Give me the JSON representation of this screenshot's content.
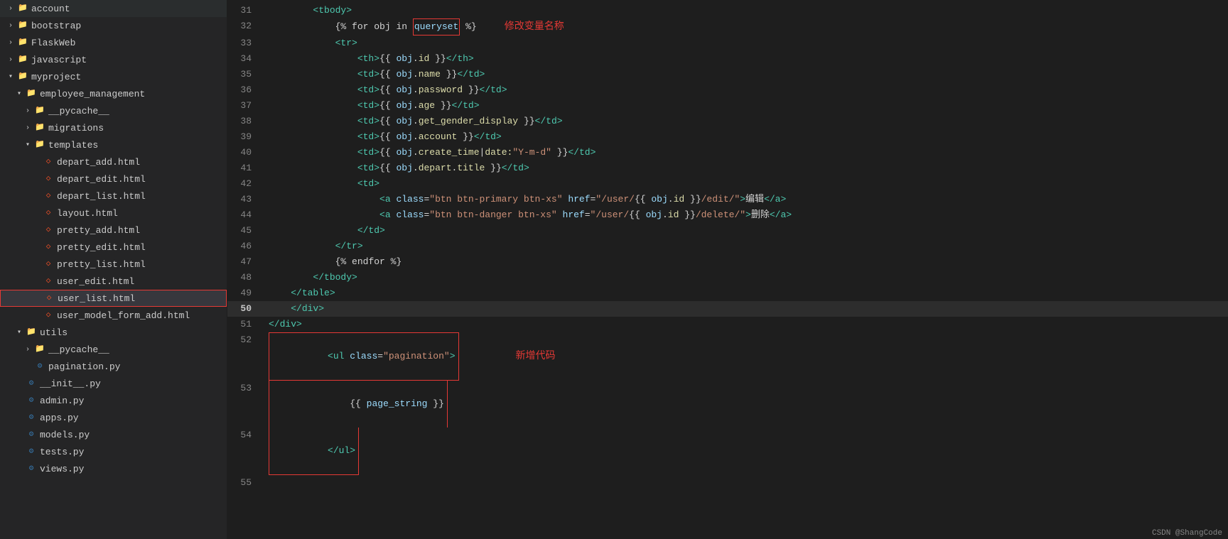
{
  "sidebar": {
    "items": [
      {
        "id": "account",
        "label": "account",
        "type": "folder",
        "indent": 0,
        "state": "closed"
      },
      {
        "id": "bootstrap",
        "label": "bootstrap",
        "type": "folder",
        "indent": 0,
        "state": "closed"
      },
      {
        "id": "flaskweb",
        "label": "FlaskWeb",
        "type": "folder",
        "indent": 0,
        "state": "closed"
      },
      {
        "id": "javascript",
        "label": "javascript",
        "type": "folder",
        "indent": 0,
        "state": "closed"
      },
      {
        "id": "myproject",
        "label": "myproject",
        "type": "folder",
        "indent": 0,
        "state": "open"
      },
      {
        "id": "employee_management",
        "label": "employee_management",
        "type": "folder",
        "indent": 1,
        "state": "open"
      },
      {
        "id": "pycache1",
        "label": "__pycache__",
        "type": "folder",
        "indent": 2,
        "state": "closed"
      },
      {
        "id": "migrations",
        "label": "migrations",
        "type": "folder",
        "indent": 2,
        "state": "closed"
      },
      {
        "id": "templates",
        "label": "templates",
        "type": "folder",
        "indent": 2,
        "state": "open"
      },
      {
        "id": "depart_add",
        "label": "depart_add.html",
        "type": "html",
        "indent": 3,
        "state": "file"
      },
      {
        "id": "depart_edit",
        "label": "depart_edit.html",
        "type": "html",
        "indent": 3,
        "state": "file"
      },
      {
        "id": "depart_list",
        "label": "depart_list.html",
        "type": "html",
        "indent": 3,
        "state": "file"
      },
      {
        "id": "layout",
        "label": "layout.html",
        "type": "html",
        "indent": 3,
        "state": "file"
      },
      {
        "id": "pretty_add",
        "label": "pretty_add.html",
        "type": "html",
        "indent": 3,
        "state": "file"
      },
      {
        "id": "pretty_edit",
        "label": "pretty_edit.html",
        "type": "html",
        "indent": 3,
        "state": "file"
      },
      {
        "id": "pretty_list",
        "label": "pretty_list.html",
        "type": "html",
        "indent": 3,
        "state": "file"
      },
      {
        "id": "user_edit",
        "label": "user_edit.html",
        "type": "html",
        "indent": 3,
        "state": "file"
      },
      {
        "id": "user_list",
        "label": "user_list.html",
        "type": "html",
        "indent": 3,
        "state": "file",
        "selected": true
      },
      {
        "id": "user_model_form_add",
        "label": "user_model_form_add.html",
        "type": "html",
        "indent": 3,
        "state": "file"
      },
      {
        "id": "utils",
        "label": "utils",
        "type": "folder",
        "indent": 1,
        "state": "open"
      },
      {
        "id": "pycache2",
        "label": "__pycache__",
        "type": "folder",
        "indent": 2,
        "state": "closed"
      },
      {
        "id": "pagination_py",
        "label": "pagination.py",
        "type": "py",
        "indent": 2,
        "state": "file"
      },
      {
        "id": "init_py",
        "label": "__init__.py",
        "type": "py",
        "indent": 1,
        "state": "file"
      },
      {
        "id": "admin_py",
        "label": "admin.py",
        "type": "py",
        "indent": 1,
        "state": "file"
      },
      {
        "id": "apps_py",
        "label": "apps.py",
        "type": "py",
        "indent": 1,
        "state": "file"
      },
      {
        "id": "models_py",
        "label": "models.py",
        "type": "py",
        "indent": 1,
        "state": "file"
      },
      {
        "id": "tests_py",
        "label": "tests.py",
        "type": "py",
        "indent": 1,
        "state": "file"
      },
      {
        "id": "views_py",
        "label": "views.py",
        "type": "py",
        "indent": 1,
        "state": "file"
      }
    ]
  },
  "editor": {
    "lines": [
      {
        "num": 31,
        "active": false
      },
      {
        "num": 32,
        "active": false
      },
      {
        "num": 33,
        "active": false
      },
      {
        "num": 34,
        "active": false
      },
      {
        "num": 35,
        "active": false
      },
      {
        "num": 36,
        "active": false
      },
      {
        "num": 37,
        "active": false
      },
      {
        "num": 38,
        "active": false
      },
      {
        "num": 39,
        "active": false
      },
      {
        "num": 40,
        "active": false
      },
      {
        "num": 41,
        "active": false
      },
      {
        "num": 42,
        "active": false
      },
      {
        "num": 43,
        "active": false
      },
      {
        "num": 44,
        "active": false
      },
      {
        "num": 45,
        "active": false
      },
      {
        "num": 46,
        "active": false
      },
      {
        "num": 47,
        "active": false
      },
      {
        "num": 48,
        "active": false
      },
      {
        "num": 49,
        "active": false
      },
      {
        "num": 50,
        "active": true
      },
      {
        "num": 51,
        "active": false
      },
      {
        "num": 52,
        "active": false
      },
      {
        "num": 53,
        "active": false
      },
      {
        "num": 54,
        "active": false
      },
      {
        "num": 55,
        "active": false
      }
    ]
  },
  "annotations": {
    "modify_var": "修改变量名称",
    "new_code": "新增代码"
  },
  "watermark": "CSDN @ShangCode"
}
